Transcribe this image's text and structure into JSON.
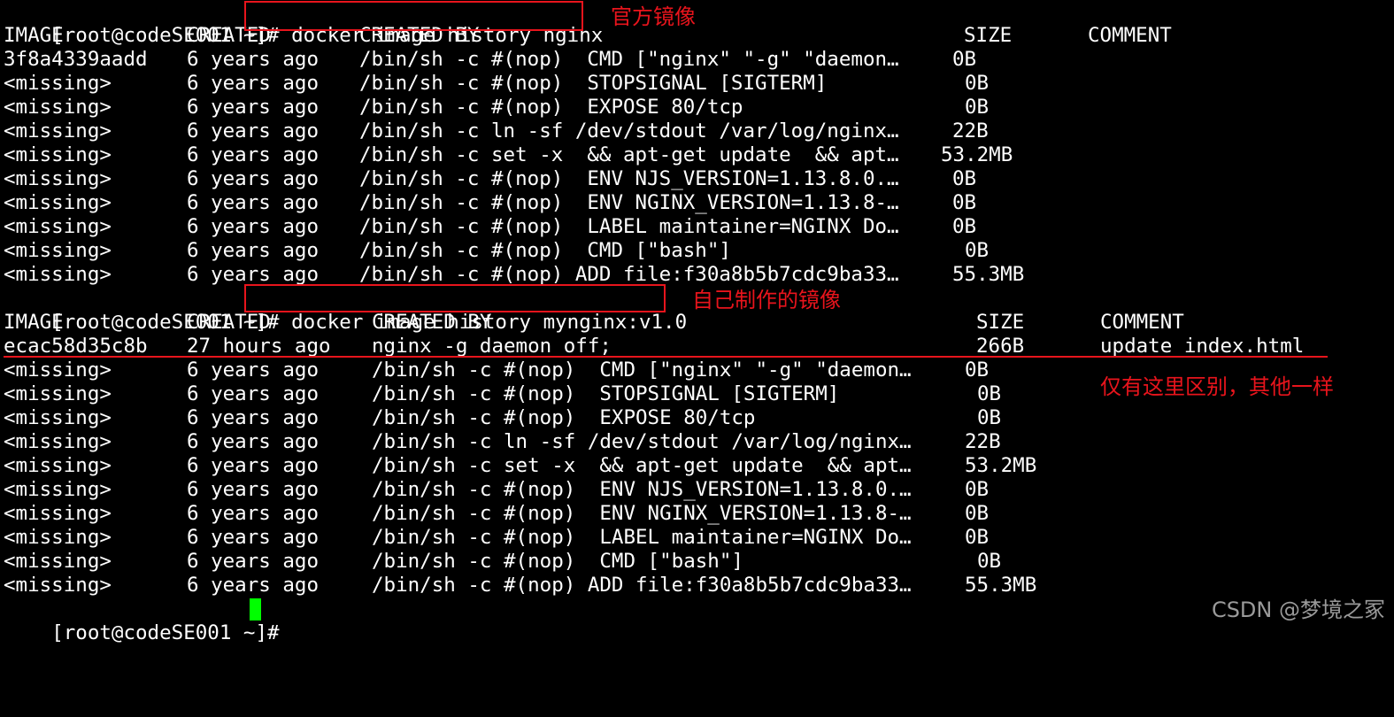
{
  "prompt": "[root@codeSE001 ~]# ",
  "commands": {
    "first": "docker image history nginx",
    "second": "docker image history mynginx:v1.0"
  },
  "annotations": {
    "official_image": "官方镜像",
    "own_image": "自己制作的镜像",
    "only_difference": "仅有这里区别，其他一样"
  },
  "table1": {
    "headers": [
      "IMAGE",
      "CREATED",
      "CREATED BY",
      "SIZE",
      "COMMENT"
    ],
    "rows": [
      {
        "image": "3f8a4339aadd",
        "created": "6 years ago",
        "by": "/bin/sh -c #(nop)  CMD [\"nginx\" \"-g\" \"daemon…",
        "size": "0B",
        "comment": ""
      },
      {
        "image": "<missing>",
        "created": "6 years ago",
        "by": "/bin/sh -c #(nop)  STOPSIGNAL [SIGTERM]",
        "size": "0B",
        "comment": ""
      },
      {
        "image": "<missing>",
        "created": "6 years ago",
        "by": "/bin/sh -c #(nop)  EXPOSE 80/tcp",
        "size": "0B",
        "comment": ""
      },
      {
        "image": "<missing>",
        "created": "6 years ago",
        "by": "/bin/sh -c ln -sf /dev/stdout /var/log/nginx…",
        "size": "22B",
        "comment": ""
      },
      {
        "image": "<missing>",
        "created": "6 years ago",
        "by": "/bin/sh -c set -x  && apt-get update  && apt…",
        "size": "53.2MB",
        "comment": ""
      },
      {
        "image": "<missing>",
        "created": "6 years ago",
        "by": "/bin/sh -c #(nop)  ENV NJS_VERSION=1.13.8.0.…",
        "size": "0B",
        "comment": ""
      },
      {
        "image": "<missing>",
        "created": "6 years ago",
        "by": "/bin/sh -c #(nop)  ENV NGINX_VERSION=1.13.8-…",
        "size": "0B",
        "comment": ""
      },
      {
        "image": "<missing>",
        "created": "6 years ago",
        "by": "/bin/sh -c #(nop)  LABEL maintainer=NGINX Do…",
        "size": "0B",
        "comment": ""
      },
      {
        "image": "<missing>",
        "created": "6 years ago",
        "by": "/bin/sh -c #(nop)  CMD [\"bash\"]",
        "size": "0B",
        "comment": ""
      },
      {
        "image": "<missing>",
        "created": "6 years ago",
        "by": "/bin/sh -c #(nop) ADD file:f30a8b5b7cdc9ba33…",
        "size": "55.3MB",
        "comment": ""
      }
    ]
  },
  "table2": {
    "headers": [
      "IMAGE",
      "CREATED",
      "CREATED BY",
      "SIZE",
      "COMMENT"
    ],
    "rows": [
      {
        "image": "ecac58d35c8b",
        "created": "27 hours ago",
        "by": "nginx -g daemon off;",
        "size": "266B",
        "comment": "update index.html"
      },
      {
        "image": "<missing>",
        "created": "6 years ago",
        "by": "/bin/sh -c #(nop)  CMD [\"nginx\" \"-g\" \"daemon…",
        "size": "0B",
        "comment": ""
      },
      {
        "image": "<missing>",
        "created": "6 years ago",
        "by": "/bin/sh -c #(nop)  STOPSIGNAL [SIGTERM]",
        "size": "0B",
        "comment": ""
      },
      {
        "image": "<missing>",
        "created": "6 years ago",
        "by": "/bin/sh -c #(nop)  EXPOSE 80/tcp",
        "size": "0B",
        "comment": ""
      },
      {
        "image": "<missing>",
        "created": "6 years ago",
        "by": "/bin/sh -c ln -sf /dev/stdout /var/log/nginx…",
        "size": "22B",
        "comment": ""
      },
      {
        "image": "<missing>",
        "created": "6 years ago",
        "by": "/bin/sh -c set -x  && apt-get update  && apt…",
        "size": "53.2MB",
        "comment": ""
      },
      {
        "image": "<missing>",
        "created": "6 years ago",
        "by": "/bin/sh -c #(nop)  ENV NJS_VERSION=1.13.8.0.…",
        "size": "0B",
        "comment": ""
      },
      {
        "image": "<missing>",
        "created": "6 years ago",
        "by": "/bin/sh -c #(nop)  ENV NGINX_VERSION=1.13.8-…",
        "size": "0B",
        "comment": ""
      },
      {
        "image": "<missing>",
        "created": "6 years ago",
        "by": "/bin/sh -c #(nop)  LABEL maintainer=NGINX Do…",
        "size": "0B",
        "comment": ""
      },
      {
        "image": "<missing>",
        "created": "6 years ago",
        "by": "/bin/sh -c #(nop)  CMD [\"bash\"]",
        "size": "0B",
        "comment": ""
      },
      {
        "image": "<missing>",
        "created": "6 years ago",
        "by": "/bin/sh -c #(nop) ADD file:f30a8b5b7cdc9ba33…",
        "size": "55.3MB",
        "comment": ""
      }
    ]
  },
  "watermark": "CSDN @梦境之冢",
  "colors": {
    "background": "#000000",
    "text": "#ffffff",
    "annotation": "#e8141c",
    "cursor": "#00ff00",
    "watermark": "#9a9a9a"
  }
}
